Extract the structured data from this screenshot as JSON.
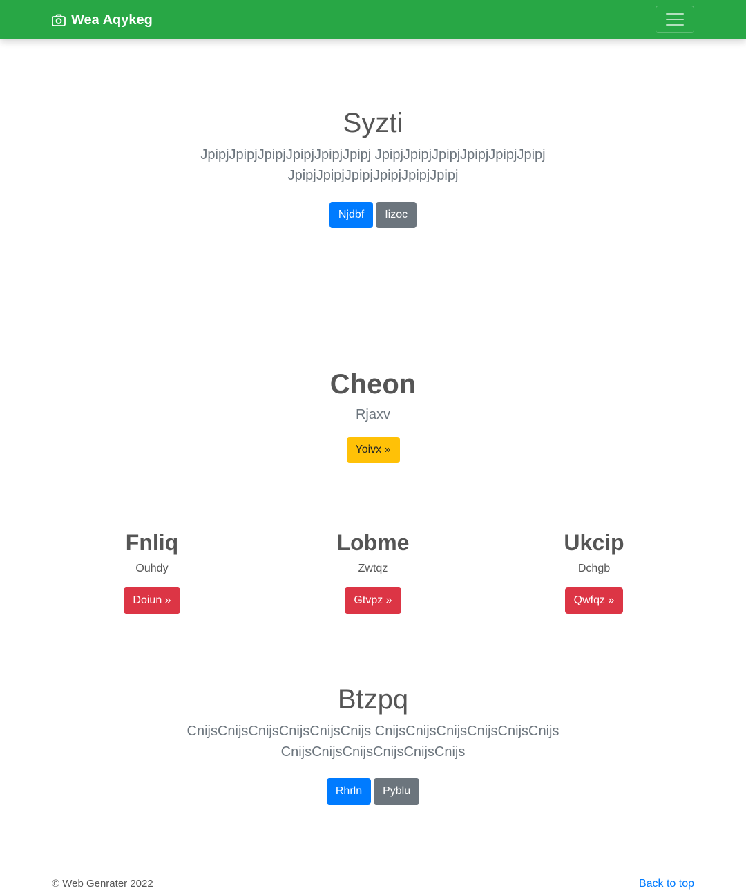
{
  "navbar": {
    "brand": "Wea Aqykeg",
    "brand_icon": "camera-icon",
    "toggler_icon": "hamburger-menu-icon",
    "background": "#28a745"
  },
  "hero1": {
    "title": "Syzti",
    "text_line1": "JpipjJpipjJpipjJpipjJpipjJpipj JpipjJpipjJpipjJpipjJpipjJpipj",
    "text_line2": "JpipjJpipjJpipjJpipjJpipjJpipj",
    "primary_label": "Njdbf",
    "secondary_label": "Iizoc"
  },
  "feature": {
    "title": "Cheon",
    "subtitle": "Rjaxv",
    "button_label": "Yoivx »"
  },
  "columns": [
    {
      "title": "Fnliq",
      "subtitle": "Ouhdy",
      "button_label": "Doiun »"
    },
    {
      "title": "Lobme",
      "subtitle": "Zwtqz",
      "button_label": "Gtvpz »"
    },
    {
      "title": "Ukcip",
      "subtitle": "Dchgb",
      "button_label": "Qwfqz »"
    }
  ],
  "hero2": {
    "title": "Btzpq",
    "text_line1": "CnijsCnijsCnijsCnijsCnijsCnijs CnijsCnijsCnijsCnijsCnijsCnijs",
    "text_line2": "CnijsCnijsCnijsCnijsCnijsCnijs",
    "primary_label": "Rhrln",
    "secondary_label": "Pyblu"
  },
  "footer": {
    "copyright": "© Web Genrater 2022",
    "back_to_top": "Back to top"
  },
  "colors": {
    "primary": "#007bff",
    "secondary": "#6c757d",
    "warning": "#ffc107",
    "danger": "#dc3545"
  }
}
